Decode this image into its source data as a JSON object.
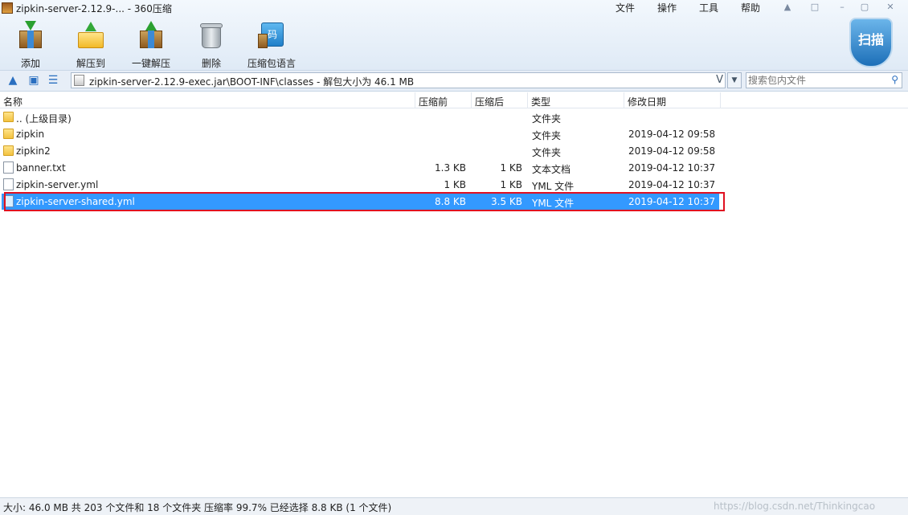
{
  "window": {
    "title": "zipkin-server-2.12.9-... - 360压缩",
    "menu": [
      "文件",
      "操作",
      "工具",
      "帮助"
    ]
  },
  "toolbar": [
    {
      "label": "添加",
      "icon": "add-archive-icon"
    },
    {
      "label": "解压到",
      "icon": "extract-to-icon"
    },
    {
      "label": "一键解压",
      "icon": "one-click-extract-icon"
    },
    {
      "label": "删除",
      "icon": "delete-icon"
    },
    {
      "label": "压缩包语言",
      "icon": "archive-language-icon"
    }
  ],
  "toolbar_lang_glyph": "码",
  "scan_button": "扫描",
  "address": {
    "path": "zipkin-server-2.12.9-exec.jar\\BOOT-INF\\classes - 解包大小为 46.1 MB",
    "vmark": "V"
  },
  "search": {
    "placeholder": "搜索包内文件"
  },
  "columns": {
    "name": "名称",
    "packed": "压缩前",
    "compressed": "压缩后",
    "type": "类型",
    "modified": "修改日期"
  },
  "files": [
    {
      "name": ".. (上级目录)",
      "packed": "",
      "compressed": "",
      "type": "文件夹",
      "modified": ""
    },
    {
      "name": "zipkin",
      "packed": "",
      "compressed": "",
      "type": "文件夹",
      "modified": "2019-04-12 09:58"
    },
    {
      "name": "zipkin2",
      "packed": "",
      "compressed": "",
      "type": "文件夹",
      "modified": "2019-04-12 09:58"
    },
    {
      "name": "banner.txt",
      "packed": "1.3 KB",
      "compressed": "1 KB",
      "type": "文本文档",
      "modified": "2019-04-12 10:37"
    },
    {
      "name": "zipkin-server.yml",
      "packed": "1 KB",
      "compressed": "1 KB",
      "type": "YML 文件",
      "modified": "2019-04-12 10:37"
    },
    {
      "name": "zipkin-server-shared.yml",
      "packed": "8.8 KB",
      "compressed": "3.5 KB",
      "type": "YML 文件",
      "modified": "2019-04-12 10:37"
    }
  ],
  "status": {
    "text": "大小: 46.0 MB 共 203 个文件和 18 个文件夹 压缩率 99.7% 已经选择 8.8 KB (1 个文件)",
    "watermark": "https://blog.csdn.net/Thinkingcao"
  }
}
